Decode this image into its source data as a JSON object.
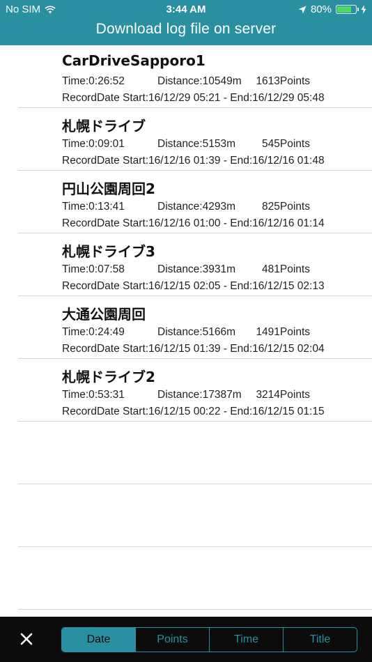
{
  "status_bar": {
    "carrier": "No SIM",
    "time": "3:44 AM",
    "battery": "80%",
    "battery_level": 0.8
  },
  "header": {
    "title": "Download log file on server"
  },
  "logs": [
    {
      "title": "CarDriveSapporo1",
      "time": "Time:0:26:52",
      "distance": "Distance:10549m",
      "points": "1613Points",
      "record": "RecordDate Start:16/12/29 05:21 - End:16/12/29 05:48"
    },
    {
      "title": "札幌ドライブ",
      "time": "Time:0:09:01",
      "distance": "Distance:5153m",
      "points": "545Points",
      "record": "RecordDate Start:16/12/16 01:39 - End:16/12/16 01:48"
    },
    {
      "title": "円山公園周回2",
      "time": "Time:0:13:41",
      "distance": "Distance:4293m",
      "points": "825Points",
      "record": "RecordDate Start:16/12/16 01:00 - End:16/12/16 01:14"
    },
    {
      "title": "札幌ドライブ3",
      "time": "Time:0:07:58",
      "distance": "Distance:3931m",
      "points": "481Points",
      "record": "RecordDate Start:16/12/15 02:05 - End:16/12/15 02:13"
    },
    {
      "title": "大通公園周回",
      "time": "Time:0:24:49",
      "distance": "Distance:5166m",
      "points": "1491Points",
      "record": "RecordDate Start:16/12/15 01:39 - End:16/12/15 02:04"
    },
    {
      "title": "札幌ドライブ2",
      "time": "Time:0:53:31",
      "distance": "Distance:17387m",
      "points": "3214Points",
      "record": "RecordDate Start:16/12/15 00:22 - End:16/12/15 01:15"
    }
  ],
  "toolbar": {
    "close_icon": "close-icon",
    "sort_options": [
      "Date",
      "Points",
      "Time",
      "Title"
    ],
    "selected": "Date"
  },
  "colors": {
    "accent": "#2a8fa0",
    "toolbar_bg": "#0c0c0c",
    "battery_green": "#4cd964"
  }
}
